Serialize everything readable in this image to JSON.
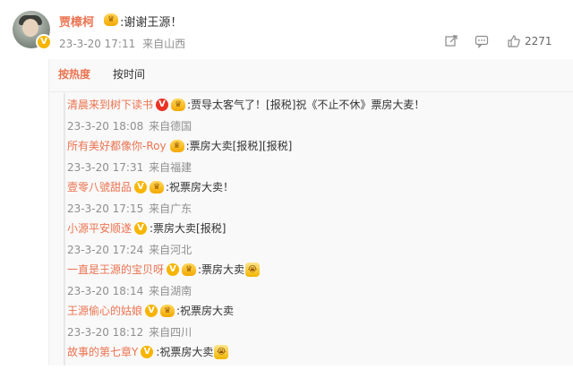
{
  "post": {
    "author": "贾樟柯",
    "text": ":谢谢王源！",
    "time": "23-3-20 17:11",
    "location": "来自山西",
    "like_count": "2271",
    "share_icon": "share-icon",
    "comment_icon": "comment-icon",
    "like_icon": "thumb-up-icon"
  },
  "sort": {
    "hot_label": "按热度",
    "time_label": "按时间"
  },
  "replies": [
    {
      "user": "清晨来到树下读书",
      "badge": "red",
      "text": ":贾导太客气了！[报税]祝《不止不休》票房大麦！",
      "emoji": "",
      "time": "23-3-20 18:08",
      "location": "来自德国"
    },
    {
      "user": "所有美好都像你-Roy",
      "badge": "none",
      "text": ":票房大卖[报税][报税]",
      "emoji": "",
      "time": "23-3-20 17:31",
      "location": "来自福建"
    },
    {
      "user": "壹零八號甜品",
      "badge": "yellow",
      "text": ":祝票房大卖！",
      "emoji": "",
      "time": "23-3-20 17:15",
      "location": "来自广东"
    },
    {
      "user": "小源平安顺遂",
      "badge": "yellow",
      "text": ":票房大卖[报税]",
      "emoji": "",
      "time": "23-3-20 17:24",
      "location": "来自河北"
    },
    {
      "user": "一直是王源的宝贝呀",
      "badge": "yellow",
      "text": ":票房大卖",
      "emoji": "😭",
      "time": "23-3-20 18:14",
      "location": "来自湖南"
    },
    {
      "user": "王源偷心的姑娘",
      "badge": "yellow",
      "text": ":祝票房大卖",
      "emoji": "",
      "time": "23-3-20 18:12",
      "location": "来自四川"
    },
    {
      "user": "故事的第七章Y",
      "badge": "yellow",
      "text": ":祝票房大卖",
      "emoji": "😭",
      "time": "",
      "location": ""
    }
  ]
}
